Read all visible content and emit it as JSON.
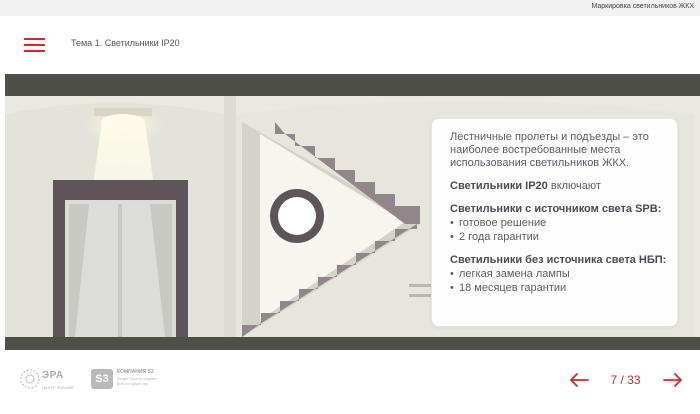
{
  "window": {
    "title": "Маркировка светильников ЖКХ"
  },
  "header": {
    "menu_icon": "hamburger-icon",
    "topic": "Тема 1. Светильники IP20"
  },
  "card": {
    "intro": "Лестничные пролеты и подъезды – это наиболее востребованные места использования светильников ЖКХ.",
    "includes_prefix": "Светильники IP20",
    "includes_suffix": " включают",
    "spb_title": "Светильники с источником света SPB:",
    "spb_items": [
      "готовое решение",
      "2 года гарантии"
    ],
    "nbp_title": "Светильники без источника света НБП:",
    "nbp_items": [
      "легкая замена лампы",
      "18 месяцев гарантии"
    ]
  },
  "footer": {
    "era_name": "ЭРА",
    "era_sub": "ЦЕНТР ЗНАНИЙ",
    "s3_mark": "S3",
    "s3_name": "КОМПАНИЯ S3",
    "s3_tag1": "Single Source Supplier",
    "s3_tag2": "Всё из одних рук"
  },
  "navigation": {
    "prev_icon": "arrow-left-icon",
    "next_icon": "arrow-right-icon",
    "current": 7,
    "total": 33,
    "counter": "7 / 33"
  },
  "colors": {
    "accent": "#d7272a",
    "wall": "#e9e9e1",
    "dark_frame": "#5d5557",
    "band": "#4f4f4a"
  }
}
